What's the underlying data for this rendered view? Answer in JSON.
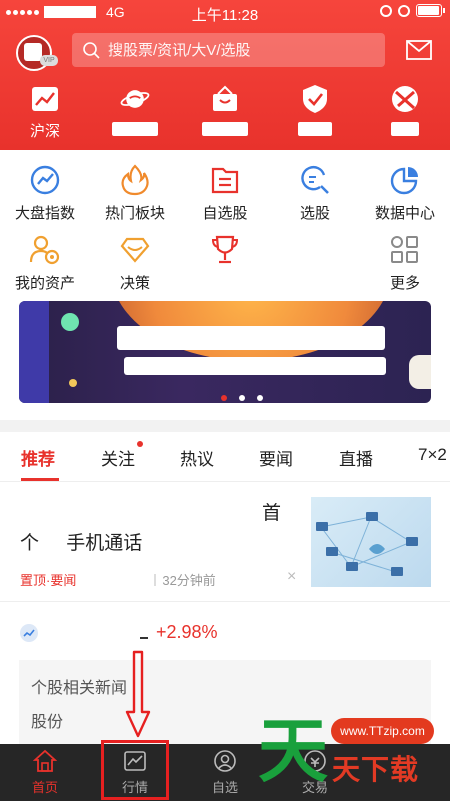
{
  "status_bar": {
    "network": "4G",
    "time": "上午11:28",
    "battery_level": 0.95
  },
  "search": {
    "placeholder": "搜股票/资讯/大V/选股"
  },
  "quick_nav": [
    {
      "label": "沪深",
      "icon": "chart-trend-icon"
    },
    {
      "label": "",
      "icon": "planet-icon"
    },
    {
      "label": "",
      "icon": "basket-icon"
    },
    {
      "label": "",
      "icon": "shield-check-icon"
    },
    {
      "label": "",
      "icon": "globe-icon"
    }
  ],
  "grid_row1": [
    {
      "label": "大盘指数",
      "icon": "index-trend-icon"
    },
    {
      "label": "热门板块",
      "icon": "fire-icon"
    },
    {
      "label": "自选股",
      "icon": "folder-doc-icon"
    },
    {
      "label": "选股",
      "icon": "search-list-icon"
    },
    {
      "label": "数据中心",
      "icon": "pie-chart-icon"
    }
  ],
  "grid_row2": [
    {
      "label": "我的资产",
      "icon": "user-coin-icon"
    },
    {
      "label": "决策",
      "icon": "diamond-icon"
    },
    {
      "label": "",
      "icon": "trophy-icon"
    },
    {
      "label": "",
      "icon": "blank"
    },
    {
      "label": "更多",
      "icon": "grid-more-icon"
    }
  ],
  "banner": {
    "slides": 3,
    "active_slide": 1
  },
  "tabs": [
    "推荐",
    "关注",
    "热议",
    "要闻",
    "直播",
    "7×2"
  ],
  "active_tab": 0,
  "article": {
    "title_end": "首",
    "title_line2": "个 手机通话",
    "tag": "置顶·要闻",
    "time": "32分钟前",
    "close": "×"
  },
  "stock": {
    "change": "+2.98%"
  },
  "related": {
    "title": "个股相关新闻",
    "snippet": "股份"
  },
  "bottom_nav": [
    {
      "label": "首页",
      "icon": "home-icon"
    },
    {
      "label": "行情",
      "icon": "market-chart-icon"
    },
    {
      "label": "自选",
      "icon": "user-circle-icon"
    },
    {
      "label": "交易",
      "icon": "trade-icon"
    }
  ],
  "active_nav": 0,
  "watermark": {
    "url": "www.TTzip.com",
    "big": "天",
    "small": "天下载"
  },
  "colors": {
    "brand_red": "#e8322c",
    "nav_bg": "#262626",
    "watermark_green": "#19a03c"
  }
}
